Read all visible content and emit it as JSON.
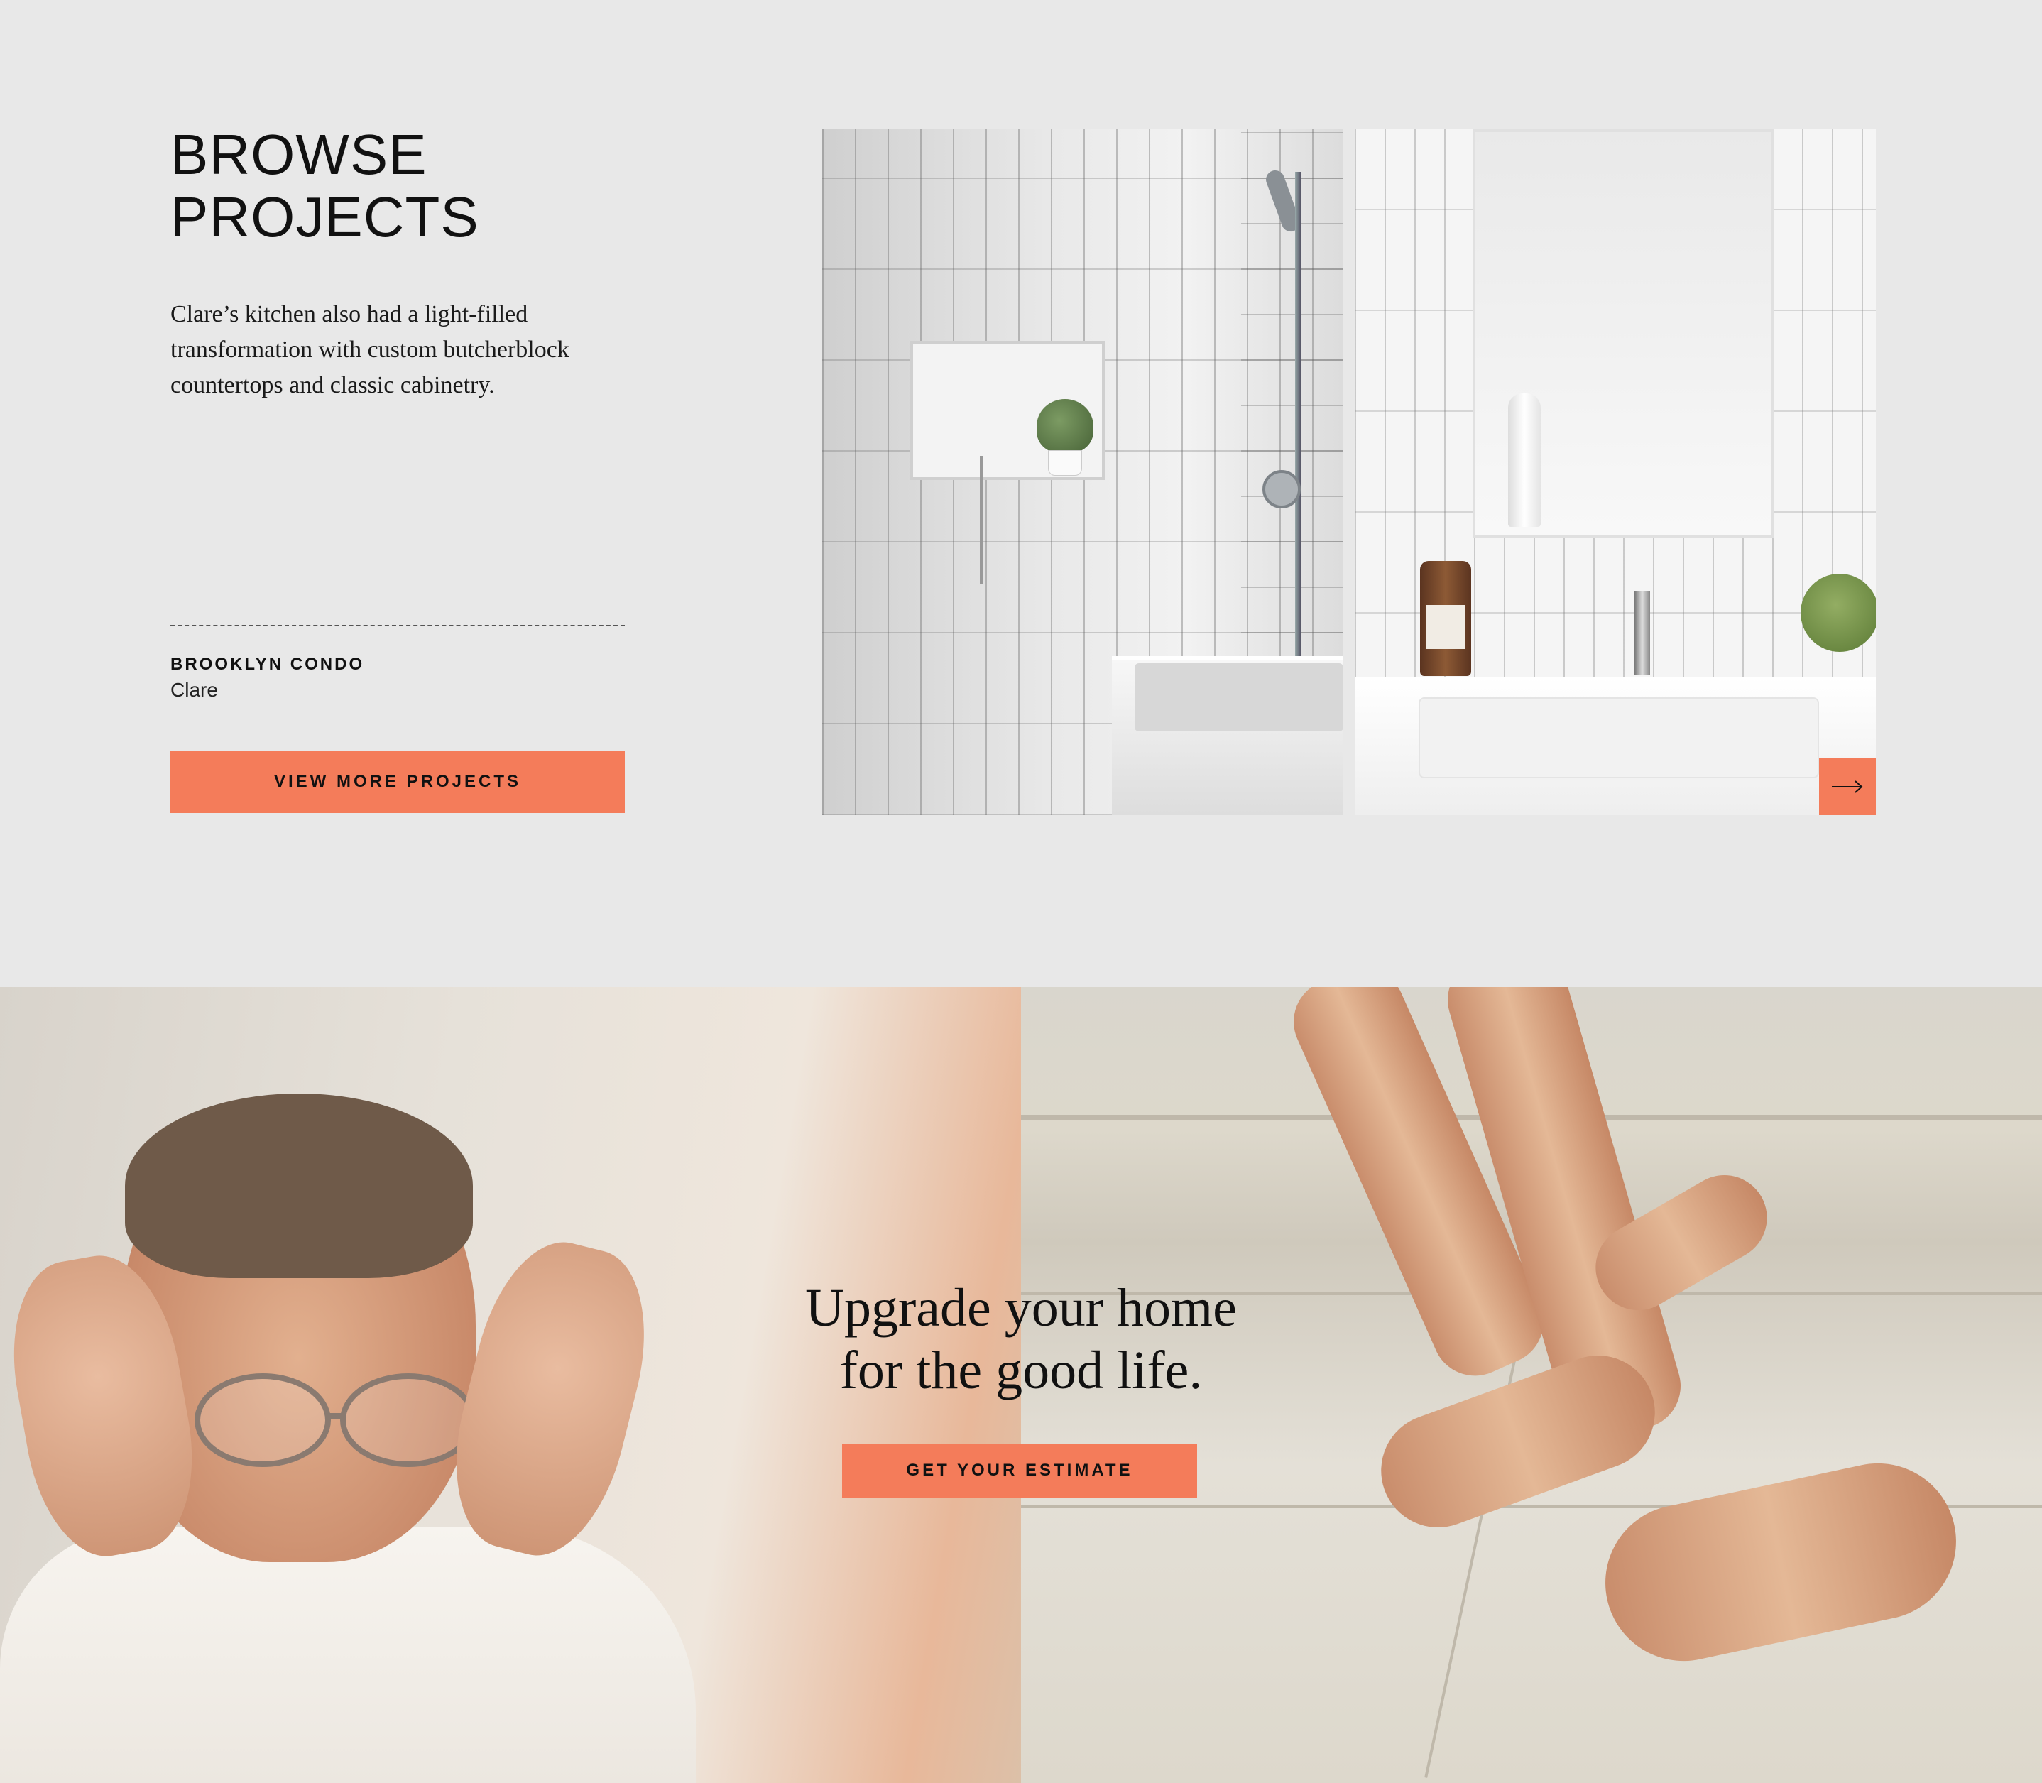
{
  "browse": {
    "title_line1": "BROWSE",
    "title_line2": "PROJECTS",
    "description": "Clare’s kitchen also had a light-filled transformation with custom butcherblock countertops and classic cabinetry.",
    "project_name": "BROOKLYN CONDO",
    "project_client": "Clare",
    "cta_label": "VIEW MORE PROJECTS",
    "next_icon": "arrow-right-icon"
  },
  "hero": {
    "headline_line1": "Upgrade your home",
    "headline_line2": "for the good life.",
    "cta_label": "GET YOUR ESTIMATE"
  },
  "colors": {
    "background": "#e8e8e8",
    "accent": "#f47c5a",
    "text": "#111111"
  }
}
